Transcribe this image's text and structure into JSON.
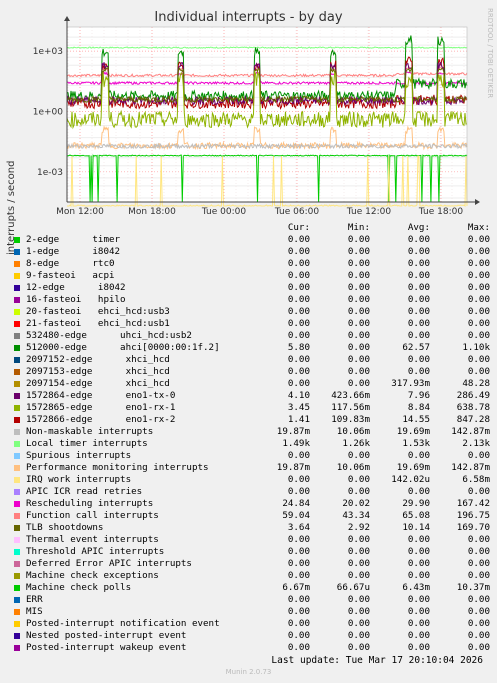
{
  "chart_data": {
    "type": "line",
    "title": "Individual interrupts - by day",
    "ylabel": "interrupts / second",
    "yscale": "log",
    "ylim": [
      1e-05,
      100000
    ],
    "yticks": [
      "1e+03",
      "1e+00",
      "1e-03"
    ],
    "xticks": [
      "Mon 12:00",
      "Mon 18:00",
      "Tue 00:00",
      "Tue 06:00",
      "Tue 12:00",
      "Tue 18:00"
    ],
    "grid": true,
    "columns": [
      "Cur:",
      "Min:",
      "Avg:",
      "Max:"
    ],
    "series": [
      {
        "name": "2-edge      timer",
        "color": "#00cc00",
        "values": [
          "0.00",
          "0.00",
          "0.00",
          "0.00"
        ]
      },
      {
        "name": "1-edge      i8042",
        "color": "#0066b3",
        "values": [
          "0.00",
          "0.00",
          "0.00",
          "0.00"
        ]
      },
      {
        "name": "8-edge      rtc0",
        "color": "#ff8000",
        "values": [
          "0.00",
          "0.00",
          "0.00",
          "0.00"
        ]
      },
      {
        "name": "9-fasteoi   acpi",
        "color": "#ffcc00",
        "values": [
          "0.00",
          "0.00",
          "0.00",
          "0.00"
        ]
      },
      {
        "name": "12-edge      i8042",
        "color": "#330099",
        "values": [
          "0.00",
          "0.00",
          "0.00",
          "0.00"
        ]
      },
      {
        "name": "16-fasteoi   hpilo",
        "color": "#990099",
        "values": [
          "0.00",
          "0.00",
          "0.00",
          "0.00"
        ]
      },
      {
        "name": "20-fasteoi   ehci_hcd:usb3",
        "color": "#ccff00",
        "values": [
          "0.00",
          "0.00",
          "0.00",
          "0.00"
        ]
      },
      {
        "name": "21-fasteoi   ehci_hcd:usb1",
        "color": "#ff0000",
        "values": [
          "0.00",
          "0.00",
          "0.00",
          "0.00"
        ]
      },
      {
        "name": "532480-edge      uhci_hcd:usb2",
        "color": "#808080",
        "values": [
          "0.00",
          "0.00",
          "0.00",
          "0.00"
        ]
      },
      {
        "name": "512000-edge      ahci[0000:00:1f.2]",
        "color": "#008f00",
        "values": [
          "5.80",
          "0.00",
          "62.57",
          "1.10k"
        ]
      },
      {
        "name": "2097152-edge      xhci_hcd",
        "color": "#00487d",
        "values": [
          "0.00",
          "0.00",
          "0.00",
          "0.00"
        ]
      },
      {
        "name": "2097153-edge      xhci_hcd",
        "color": "#b35a00",
        "values": [
          "0.00",
          "0.00",
          "0.00",
          "0.00"
        ]
      },
      {
        "name": "2097154-edge      xhci_hcd",
        "color": "#b38f00",
        "values": [
          "0.00",
          "0.00",
          "317.93m",
          "48.28"
        ]
      },
      {
        "name": "1572864-edge      eno1-tx-0",
        "color": "#6b006b",
        "values": [
          "4.10",
          "423.66m",
          "7.96",
          "286.49"
        ]
      },
      {
        "name": "1572865-edge      eno1-rx-1",
        "color": "#8fb300",
        "values": [
          "3.45",
          "117.56m",
          "8.84",
          "638.78"
        ]
      },
      {
        "name": "1572866-edge      eno1-rx-2",
        "color": "#b30000",
        "values": [
          "1.41",
          "109.83m",
          "14.55",
          "847.28"
        ]
      },
      {
        "name": "Non-maskable interrupts",
        "color": "#bebebe",
        "values": [
          "19.87m",
          "10.06m",
          "19.69m",
          "142.87m"
        ]
      },
      {
        "name": "Local timer interrupts",
        "color": "#80ff80",
        "values": [
          "1.49k",
          "1.26k",
          "1.53k",
          "2.13k"
        ]
      },
      {
        "name": "Spurious interrupts",
        "color": "#80c9ff",
        "values": [
          "0.00",
          "0.00",
          "0.00",
          "0.00"
        ]
      },
      {
        "name": "Performance monitoring interrupts",
        "color": "#ffc080",
        "values": [
          "19.87m",
          "10.06m",
          "19.69m",
          "142.87m"
        ]
      },
      {
        "name": "IRQ work interrupts",
        "color": "#ffe680",
        "values": [
          "0.00",
          "0.00",
          "142.02u",
          "6.58m"
        ]
      },
      {
        "name": "APIC ICR read retries",
        "color": "#aa80ff",
        "values": [
          "0.00",
          "0.00",
          "0.00",
          "0.00"
        ]
      },
      {
        "name": "Rescheduling interrupts",
        "color": "#ee00cc",
        "values": [
          "24.84",
          "20.02",
          "29.90",
          "167.42"
        ]
      },
      {
        "name": "Function call interrupts",
        "color": "#ff8080",
        "values": [
          "59.04",
          "43.34",
          "65.08",
          "196.75"
        ]
      },
      {
        "name": "TLB shootdowns",
        "color": "#666600",
        "values": [
          "3.64",
          "2.92",
          "10.14",
          "169.70"
        ]
      },
      {
        "name": "Thermal event interrupts",
        "color": "#ffbfff",
        "values": [
          "0.00",
          "0.00",
          "0.00",
          "0.00"
        ]
      },
      {
        "name": "Threshold APIC interrupts",
        "color": "#00ffcc",
        "values": [
          "0.00",
          "0.00",
          "0.00",
          "0.00"
        ]
      },
      {
        "name": "Deferred Error APIC interrupts",
        "color": "#cc6699",
        "values": [
          "0.00",
          "0.00",
          "0.00",
          "0.00"
        ]
      },
      {
        "name": "Machine check exceptions",
        "color": "#999900",
        "values": [
          "0.00",
          "0.00",
          "0.00",
          "0.00"
        ]
      },
      {
        "name": "Machine check polls",
        "color": "#00cc00",
        "values": [
          "6.67m",
          "66.67u",
          "6.43m",
          "10.37m"
        ]
      },
      {
        "name": "ERR",
        "color": "#0066b3",
        "values": [
          "0.00",
          "0.00",
          "0.00",
          "0.00"
        ]
      },
      {
        "name": "MIS",
        "color": "#ff8000",
        "values": [
          "0.00",
          "0.00",
          "0.00",
          "0.00"
        ]
      },
      {
        "name": "Posted-interrupt notification event",
        "color": "#ffcc00",
        "values": [
          "0.00",
          "0.00",
          "0.00",
          "0.00"
        ]
      },
      {
        "name": "Nested posted-interrupt event",
        "color": "#330099",
        "values": [
          "0.00",
          "0.00",
          "0.00",
          "0.00"
        ]
      },
      {
        "name": "Posted-interrupt wakeup event",
        "color": "#990099",
        "values": [
          "0.00",
          "0.00",
          "0.00",
          "0.00"
        ]
      }
    ],
    "last_update": "Last update: Tue Mar 17 20:10:04 2026",
    "watermark": "RRDTOOL / TOBI OETIKER",
    "generator": "Munin 2.0.73"
  }
}
